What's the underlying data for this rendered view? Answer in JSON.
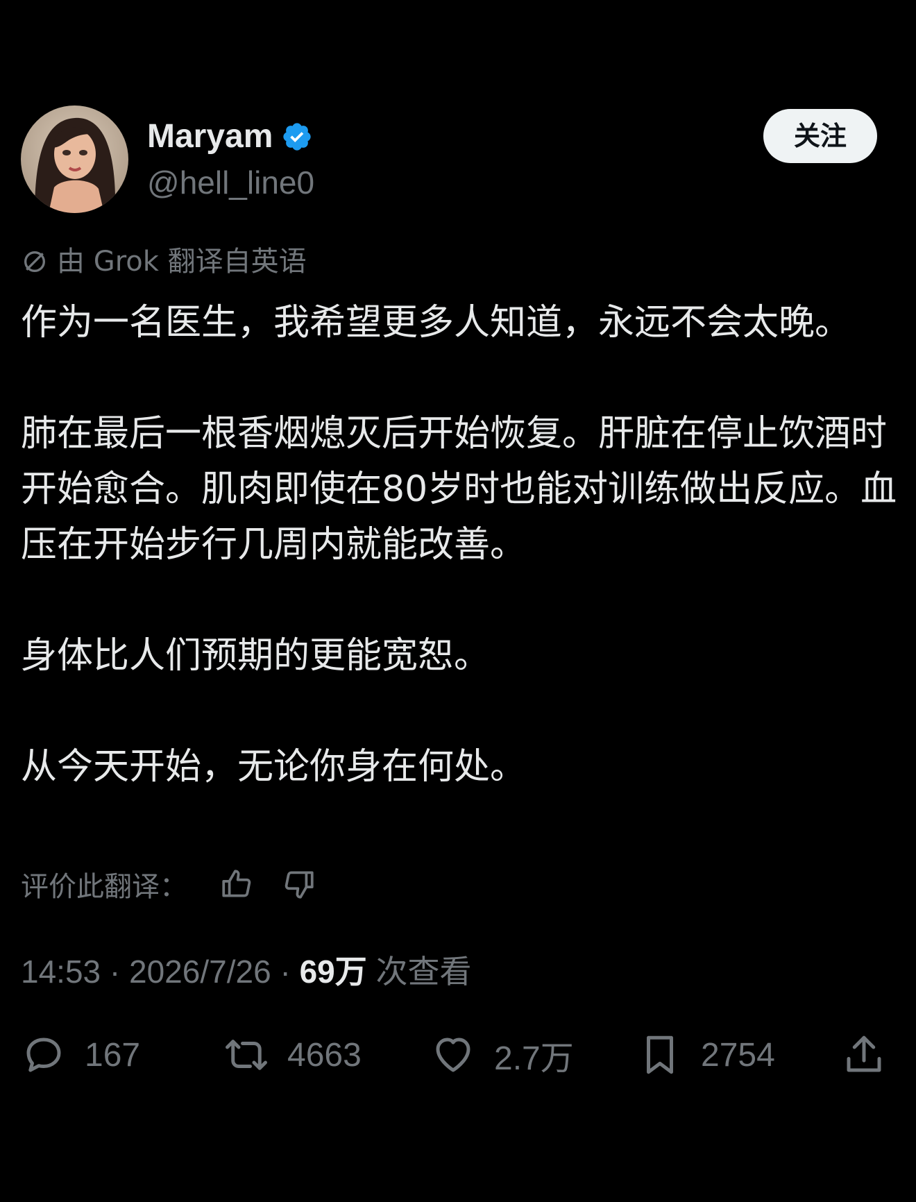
{
  "author": {
    "display_name": "Maryam",
    "handle": "@hell_line0",
    "verified": true,
    "verified_color": "#1d9bf0"
  },
  "follow_label": "关注",
  "translation_note": "由 Grok 翻译自英语",
  "tweet_text": "作为一名医生，我希望更多人知道，永远不会太晚。\n\n肺在最后一根香烟熄灭后开始恢复。肝脏在停止饮酒时开始愈合。肌肉即使在80岁时也能对训练做出反应。血压在开始步行几周内就能改善。\n\n身体比人们预期的更能宽恕。\n\n从今天开始，无论你身在何处。",
  "rate_translation_label": "评价此翻译：",
  "meta": {
    "time": "14:53",
    "date": "2026/7/26",
    "separator": "·",
    "views_count": "69万",
    "views_label": " 次查看"
  },
  "actions": {
    "replies": "167",
    "reposts": "4663",
    "likes": "2.7万",
    "bookmarks": "2754"
  },
  "icons": [
    "verified-badge-icon",
    "translate-icon",
    "thumbs-up-icon",
    "thumbs-down-icon",
    "reply-icon",
    "repost-icon",
    "like-icon",
    "bookmark-icon",
    "share-icon"
  ]
}
